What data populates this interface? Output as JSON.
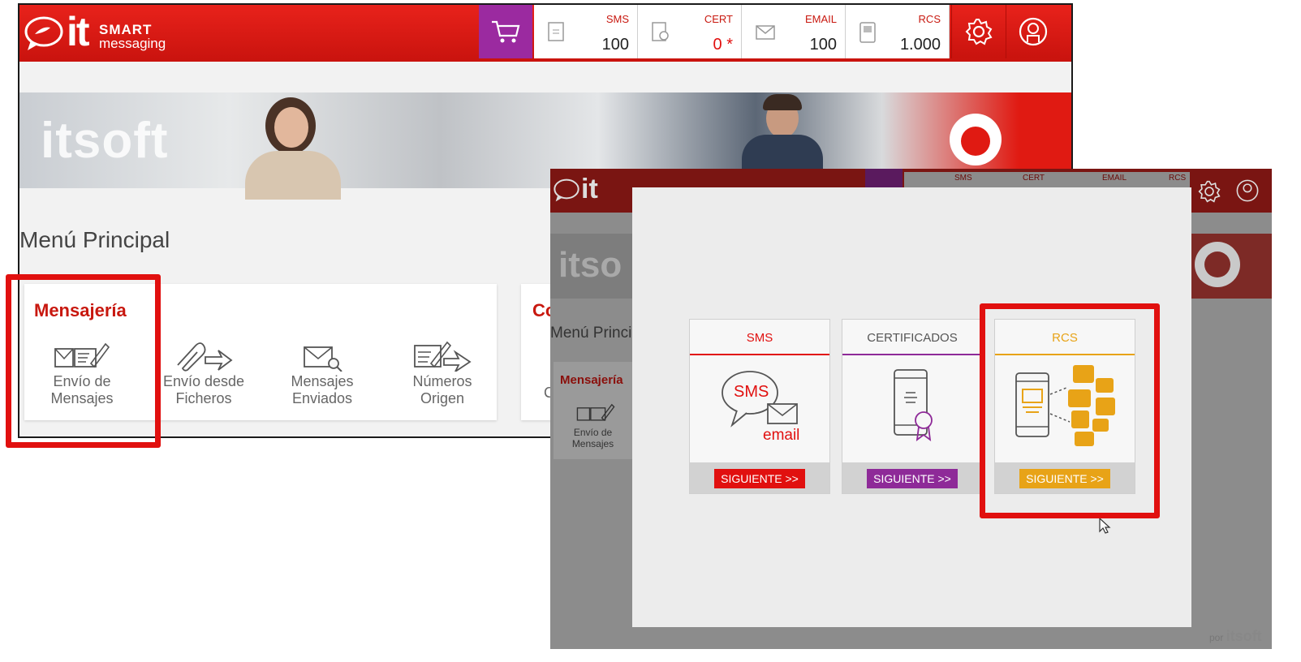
{
  "app": {
    "logo_it": "it",
    "logo_smart": "SMART",
    "logo_messaging": "messaging"
  },
  "counters": [
    {
      "label": "SMS",
      "value": "100"
    },
    {
      "label": "CERT",
      "value": "0 *"
    },
    {
      "label": "EMAIL",
      "value": "100"
    },
    {
      "label": "RCS",
      "value": "1.000"
    }
  ],
  "icons": {
    "cart": "cart-icon",
    "settings": "gear-icon",
    "user": "user-icon",
    "sms_counter": "document-icon",
    "cert_counter": "certificate-icon",
    "email_counter": "envelope-icon",
    "rcs_counter": "device-icon"
  },
  "banner": {
    "brand": "itsoft"
  },
  "main": {
    "title": "Menú Principal",
    "card_title": "Mensajería",
    "second_card_initial": "Co",
    "second_card_sub": "C",
    "items": [
      {
        "line1": "Envío de",
        "line2": "Mensajes"
      },
      {
        "line1": "Envío desde",
        "line2": "Ficheros"
      },
      {
        "line1": "Mensajes",
        "line2": "Enviados"
      },
      {
        "line1": "Números",
        "line2": "Origen"
      }
    ]
  },
  "overlay": {
    "bg_menu_title": "Menú Princi",
    "bg_card_title": "Mensajería",
    "bg_item_line1": "Envío de",
    "bg_item_line2": "Mensajes",
    "bg_brand": "itso",
    "counters_small": [
      "SMS",
      "CERT",
      "EMAIL",
      "RCS"
    ],
    "options": [
      {
        "title": "SMS",
        "button": "SIGUIENTE >>",
        "art_top": "SMS",
        "art_bottom": "email",
        "color": "#e1100f"
      },
      {
        "title": "CERTIFICADOS",
        "button": "SIGUIENTE >>",
        "color": "#8e2a98"
      },
      {
        "title": "RCS",
        "button": "SIGUIENTE >>",
        "color": "#e8a317"
      }
    ],
    "footer_pre": "por",
    "footer_brand": "itsoft"
  },
  "colors": {
    "brand_red": "#e1100f",
    "purple": "#9b2aa0",
    "rcs_orange": "#e8a317"
  }
}
